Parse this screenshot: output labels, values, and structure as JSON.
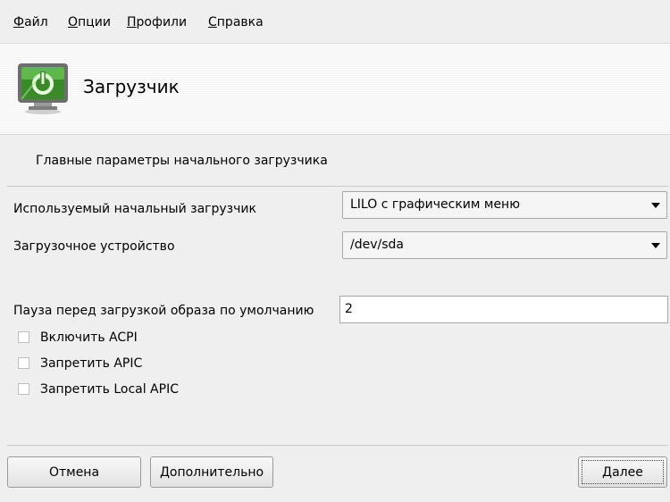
{
  "menu": [
    {
      "mnemonic": "Ф",
      "rest": "айл"
    },
    {
      "mnemonic": "О",
      "rest": "пции"
    },
    {
      "mnemonic": "П",
      "rest": "рофили"
    },
    {
      "mnemonic": "С",
      "rest": "правка"
    }
  ],
  "header": {
    "title": "Загрузчик",
    "icon": "bootloader-monitor-power-icon"
  },
  "section": {
    "description": "Главные параметры начального загрузчика"
  },
  "fields": {
    "bootloader": {
      "label": "Используемый начальный загрузчик",
      "value": "LILO с графическим меню"
    },
    "device": {
      "label": "Загрузочное устройство",
      "value": "/dev/sda"
    },
    "delay": {
      "label": "Пауза перед загрузкой образа по умолчанию",
      "value": "2"
    }
  },
  "checkboxes": [
    {
      "label": "Включить ACPI",
      "checked": false
    },
    {
      "label": "Запретить APIC",
      "checked": false
    },
    {
      "label": "Запретить Local APIC",
      "checked": false
    }
  ],
  "buttons": {
    "cancel": "Отмена",
    "advanced": "Дополнительно",
    "next": "Далее"
  }
}
